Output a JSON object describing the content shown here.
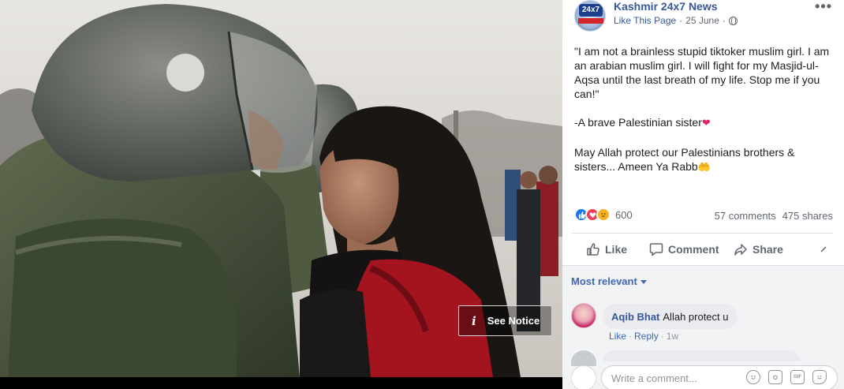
{
  "photo": {
    "notice_button_label": "See Notice",
    "notice_icon": "info-icon"
  },
  "post": {
    "page_name": "Kashmir 24x7 News",
    "page_avatar_badge": "24x7",
    "like_page_label": "Like This Page",
    "separator": "·",
    "date": "25 June",
    "separator2": "·",
    "audience_icon": "globe-icon",
    "more_icon": "•••",
    "body_paragraphs": [
      "\"I am not a brainless stupid tiktoker muslim girl. I am an arabian muslim girl. I will fight for my Masjid-ul-Aqsa until the last breath of my life. Stop me if you can!\"",
      "-A brave Palestinian sister",
      "May Allah protect our Palestinians brothers & sisters... Ameen Ya Rabb"
    ],
    "heart_emoji": "❤",
    "hands_emoji": "🤲",
    "reactions": {
      "icons": [
        "like-reaction-icon",
        "love-reaction-icon",
        "sad-reaction-icon"
      ],
      "count": "600",
      "comments": "57 comments",
      "shares": "475 shares"
    },
    "actions": {
      "like": "Like",
      "comment": "Comment",
      "share": "Share"
    }
  },
  "comments": {
    "sort_label": "Most relevant",
    "items": [
      {
        "author": "Aqib Bhat",
        "text": "Allah protect u",
        "like": "Like",
        "reply": "Reply",
        "sep": "·",
        "time": "1w"
      }
    ],
    "composer_placeholder": "Write a comment...",
    "tools": [
      "emoji-icon",
      "camera-icon",
      "gif-icon",
      "sticker-icon"
    ]
  },
  "colors": {
    "link_blue": "#385898",
    "accent_blue": "#4267b2",
    "meta_grey": "#616770",
    "comment_bg": "#f2f3f5"
  }
}
